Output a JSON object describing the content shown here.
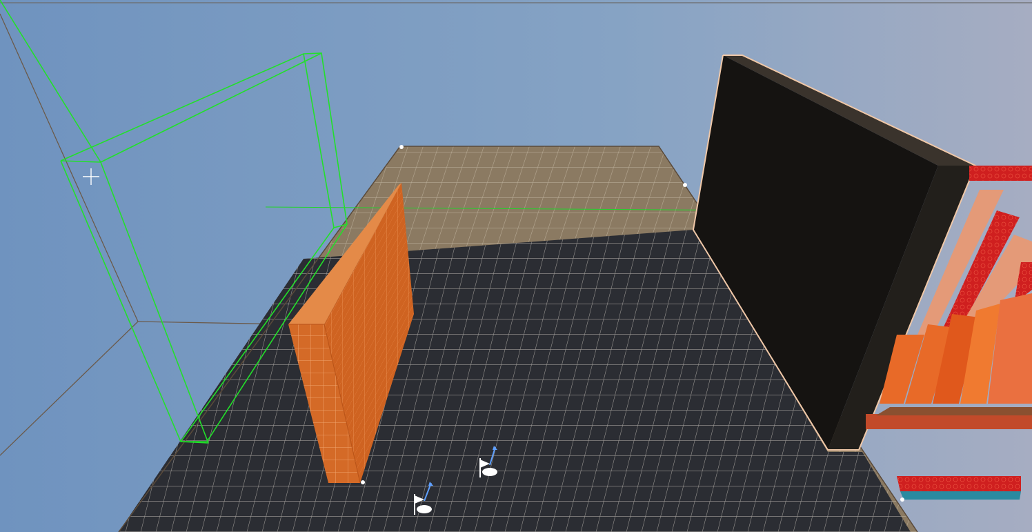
{
  "app": {
    "view": "level-editor-viewport"
  },
  "colors": {
    "sky_left": "#6f93bf",
    "sky_right": "#a4afc4",
    "floor_lit": "#8b7a62",
    "floor_shadow": "#2a2c31",
    "grid_line": "#c9c4bc",
    "orange_wall": "#d66a26",
    "black_panel": "#141210",
    "selection_green": "#22e02a",
    "red_block": "#d02020",
    "salmon_block": "#e49a78"
  },
  "scene": {
    "selected_object": "brush-box",
    "cursor": "crosshair",
    "icons": [
      "player-start-icon",
      "player-start-icon"
    ]
  }
}
